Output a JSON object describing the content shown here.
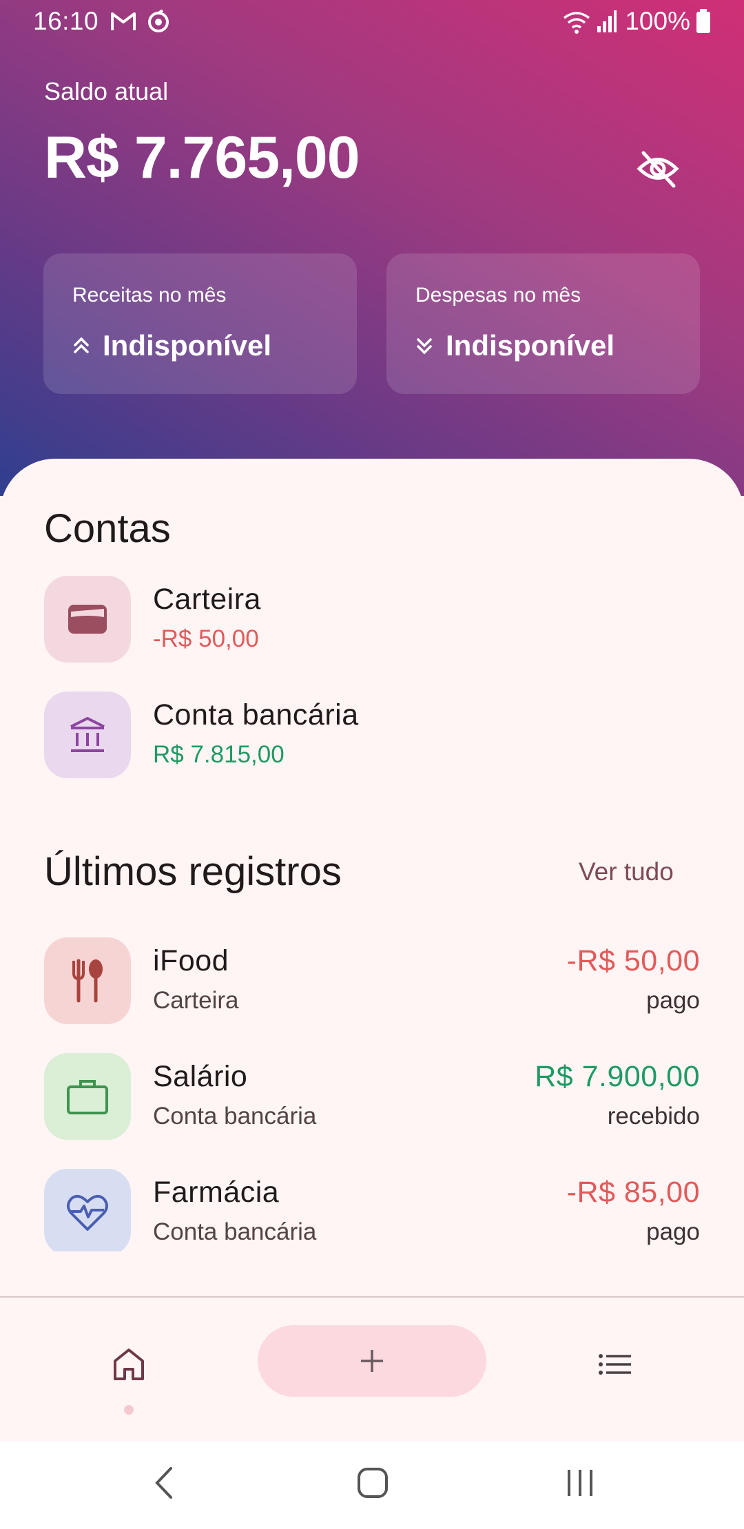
{
  "status_bar": {
    "time": "16:10",
    "battery_text": "100%",
    "icons": [
      "gmail-icon",
      "sync-icon",
      "wifi-icon",
      "signal-icon",
      "battery-icon"
    ]
  },
  "header": {
    "balance_label": "Saldo atual",
    "balance_value": "R$ 7.765,00",
    "visibility_icon": "eye-off-icon",
    "income_card": {
      "label": "Receitas no mês",
      "value": "Indisponível",
      "icon": "chevrons-up-icon"
    },
    "expense_card": {
      "label": "Despesas no mês",
      "value": "Indisponível",
      "icon": "chevrons-down-icon"
    }
  },
  "accounts": {
    "title": "Contas",
    "items": [
      {
        "name": "Carteira",
        "balance": "-R$ 50,00",
        "icon": "wallet-icon",
        "tone": "negative"
      },
      {
        "name": "Conta bancária",
        "balance": "R$ 7.815,00",
        "icon": "bank-icon",
        "tone": "positive"
      }
    ]
  },
  "records": {
    "title": "Últimos registros",
    "see_all": "Ver tudo",
    "items": [
      {
        "title": "iFood",
        "account": "Carteira",
        "amount": "-R$ 50,00",
        "status": "pago",
        "icon": "restaurant-icon",
        "tone": "negative"
      },
      {
        "title": "Salário",
        "account": "Conta bancária",
        "amount": "R$ 7.900,00",
        "status": "recebido",
        "icon": "briefcase-icon",
        "tone": "positive"
      },
      {
        "title": "Farmácia",
        "account": "Conta bancária",
        "amount": "-R$ 85,00",
        "status": "pago",
        "icon": "heart-pulse-icon",
        "tone": "negative"
      }
    ]
  },
  "bottom_nav": {
    "items": [
      "home-icon",
      "add-icon",
      "list-icon"
    ],
    "active": "home-icon"
  },
  "colors": {
    "negative": "#e25a5a",
    "positive": "#1f9a64",
    "background": "#fff5f4",
    "fab": "#fcd9df"
  }
}
